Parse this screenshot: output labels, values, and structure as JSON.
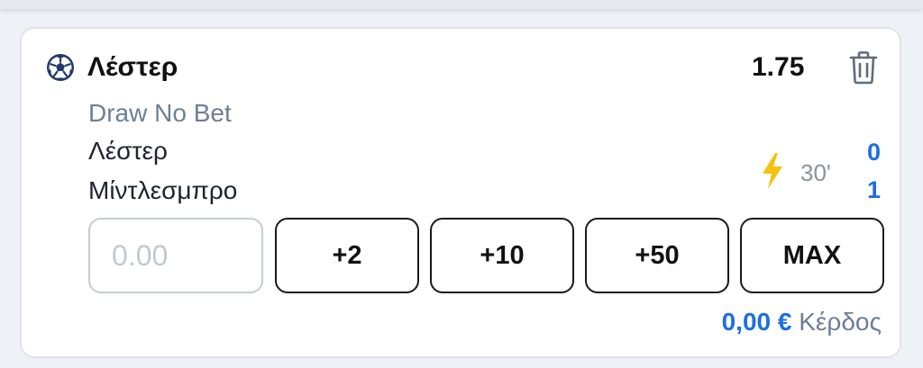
{
  "bet": {
    "selection": "Λέστερ",
    "odds": "1.75",
    "market": "Draw No Bet",
    "home_team": "Λέστερ",
    "away_team": "Μίντλεσμπρο",
    "live_minute": "30'",
    "home_score": "0",
    "away_score": "1"
  },
  "stake": {
    "placeholder": "0.00",
    "value": ""
  },
  "quick_stakes": [
    "+2",
    "+10",
    "+50",
    "MAX"
  ],
  "payout": {
    "amount": "0,00 €",
    "label": "Κέρδος"
  },
  "icons": {
    "sport": "soccer-ball-icon",
    "remove": "trash-icon",
    "live": "lightning-icon"
  },
  "colors": {
    "accent_blue": "#1e6fe0",
    "live_yellow": "#f4c20d",
    "muted_text": "#6d7f94",
    "ball_navy": "#22396b"
  }
}
